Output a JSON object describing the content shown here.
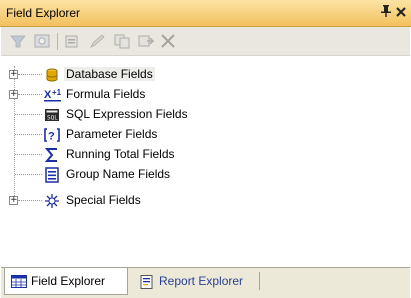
{
  "window": {
    "title": "Field Explorer",
    "pin_glyph": "❂",
    "close_glyph": "✕"
  },
  "toolbar": {
    "buttons": [
      {
        "icon": "insert-to-report-icon"
      },
      {
        "icon": "browse-data-icon"
      },
      {
        "icon": "new-icon"
      },
      {
        "icon": "edit-icon"
      },
      {
        "icon": "duplicate-icon"
      },
      {
        "icon": "rename-icon"
      },
      {
        "icon": "delete-icon"
      }
    ]
  },
  "tree": {
    "items": [
      {
        "label": "Database Fields",
        "icon": "database-icon",
        "expandable": true,
        "selected": true
      },
      {
        "label": "Formula Fields",
        "icon": "formula-icon",
        "expandable": true
      },
      {
        "label": "SQL Expression Fields",
        "icon": "sql-expression-icon",
        "expandable": false
      },
      {
        "label": "Parameter Fields",
        "icon": "parameter-icon",
        "expandable": false
      },
      {
        "label": "Running Total Fields",
        "icon": "running-total-icon",
        "expandable": false
      },
      {
        "label": "Group Name Fields",
        "icon": "group-name-icon",
        "expandable": false
      },
      {
        "label": "Special Fields",
        "icon": "special-fields-icon",
        "expandable": true
      }
    ],
    "expander_glyph": "+"
  },
  "tabs": [
    {
      "label": "Field Explorer",
      "icon": "field-explorer-tab-icon",
      "active": true
    },
    {
      "label": "Report Explorer",
      "icon": "report-explorer-tab-icon",
      "active": false
    }
  ],
  "colors": {
    "titlebar": "#f3c15d",
    "toolbar": "#e9e7df",
    "tab_link": "#2b3f97"
  }
}
